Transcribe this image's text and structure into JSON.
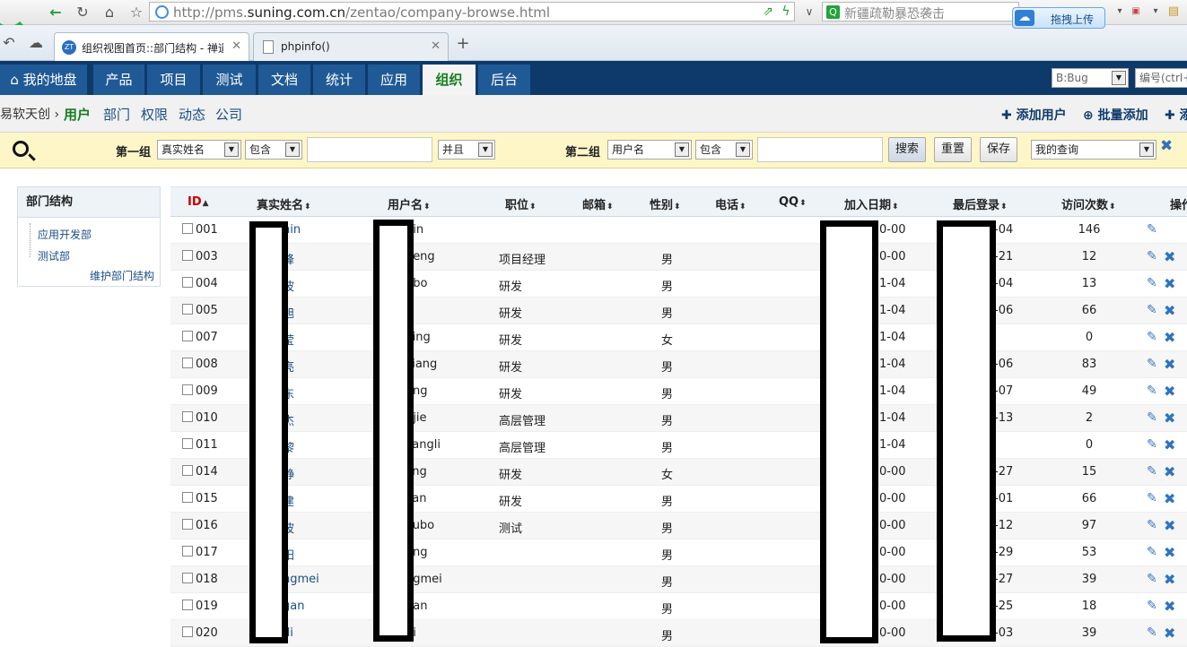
{
  "browser": {
    "url_prefix": "http://pms.",
    "url_domain": "suning.com.cn",
    "url_suffix": "/zentao/company-browse.html",
    "search_text": "新疆疏勒暴恐袭击",
    "upload_label": "拖拽上传",
    "tabs": [
      {
        "title": "组织视图首页::部门结构 - 禅道",
        "favicon": "ZT"
      },
      {
        "title": "phpinfo()"
      }
    ]
  },
  "nav": {
    "items": [
      "我的地盘",
      "产品",
      "项目",
      "测试",
      "文档",
      "统计",
      "应用",
      "组织",
      "后台"
    ],
    "active": "组织",
    "bug_select": "B:Bug",
    "id_placeholder": "编号(ctrl+g"
  },
  "subnav": {
    "crumb": "易软天创 ›",
    "links": [
      "用户",
      "部门",
      "权限",
      "动态",
      "公司"
    ],
    "active": "用户",
    "actions": [
      "添加用户",
      "批量添加",
      "添"
    ]
  },
  "search": {
    "group1_label": "第一组",
    "group1_field": "真实姓名",
    "group1_op": "包含",
    "logic": "并且",
    "group2_label": "第二组",
    "group2_field": "用户名",
    "group2_op": "包含",
    "search_btn": "搜索",
    "reset_btn": "重置",
    "save_btn": "保存",
    "query_select": "我的查询"
  },
  "dept": {
    "title": "部门结构",
    "nodes": [
      "应用开发部",
      "测试部"
    ],
    "maintain": "维护部门结构"
  },
  "table": {
    "headers": [
      "ID",
      "真实姓名",
      "用户名",
      "职位",
      "邮箱",
      "性别",
      "电话",
      "QQ",
      "加入日期",
      "最后登录",
      "访问次数",
      "操作"
    ],
    "rows": [
      {
        "id": "001",
        "name": "hin",
        "user": "hin",
        "role": "",
        "gender": "",
        "join": "0-00",
        "last": "-04",
        "visits": "146",
        "deletable": false
      },
      {
        "id": "003",
        "name": "峰",
        "user": "ifeng",
        "role": "项目经理",
        "gender": "男",
        "join": "0-00",
        "last": "-21",
        "visits": "12",
        "deletable": true
      },
      {
        "id": "004",
        "name": "波",
        "user": "gbo",
        "role": "研发",
        "gender": "男",
        "join": "1-04",
        "last": "-04",
        "visits": "13",
        "deletable": true
      },
      {
        "id": "005",
        "name": "旭",
        "user": "u",
        "role": "研发",
        "gender": "男",
        "join": "1-04",
        "last": "-06",
        "visits": "66",
        "deletable": true
      },
      {
        "id": "007",
        "name": "莹",
        "user": "ying",
        "role": "研发",
        "gender": "女",
        "join": "1-04",
        "last": "",
        "visits": "0",
        "deletable": true
      },
      {
        "id": "008",
        "name": "亮",
        "user": "iliang",
        "role": "研发",
        "gender": "男",
        "join": "1-04",
        "last": "-06",
        "visits": "83",
        "deletable": true
      },
      {
        "id": "009",
        "name": "东",
        "user": "ong",
        "role": "研发",
        "gender": "男",
        "join": "1-04",
        "last": "-07",
        "visits": "49",
        "deletable": true
      },
      {
        "id": "010",
        "name": "杰",
        "user": "njie",
        "role": "高层管理",
        "gender": "男",
        "join": "1-04",
        "last": "-13",
        "visits": "2",
        "deletable": true
      },
      {
        "id": "011",
        "name": "黎",
        "user": "kangli",
        "role": "高层管理",
        "gender": "男",
        "join": "1-04",
        "last": "",
        "visits": "0",
        "deletable": true
      },
      {
        "id": "014",
        "name": "静",
        "user": "jing",
        "role": "研发",
        "gender": "女",
        "join": "0-00",
        "last": "-27",
        "visits": "15",
        "deletable": true
      },
      {
        "id": "015",
        "name": "建",
        "user": "jian",
        "role": "研发",
        "gender": "男",
        "join": "0-00",
        "last": "-01",
        "visits": "66",
        "deletable": true
      },
      {
        "id": "016",
        "name": "波",
        "user": "xubo",
        "role": "测试",
        "gender": "男",
        "join": "0-00",
        "last": "-12",
        "visits": "97",
        "deletable": true
      },
      {
        "id": "017",
        "name": "阳",
        "user": "ang",
        "role": "",
        "gender": "男",
        "join": "0-00",
        "last": "-29",
        "visits": "53",
        "deletable": true
      },
      {
        "id": "018",
        "name": "ngmei",
        "user": "ngmei",
        "role": "",
        "gender": "男",
        "join": "0-00",
        "last": "-27",
        "visits": "39",
        "deletable": true
      },
      {
        "id": "019",
        "name": "gan",
        "user": "gan",
        "role": "",
        "gender": "男",
        "join": "0-00",
        "last": "-25",
        "visits": "18",
        "deletable": true
      },
      {
        "id": "020",
        "name": "di",
        "user": "di",
        "role": "",
        "gender": "男",
        "join": "0-00",
        "last": "-03",
        "visits": "39",
        "deletable": true
      }
    ]
  },
  "colors": {
    "nav_bg": "#0e3a6b",
    "nav_item": "#1f5a96",
    "active_green": "#167d21",
    "search_bg": "#fff6c8",
    "link_blue": "#1a4f85"
  }
}
